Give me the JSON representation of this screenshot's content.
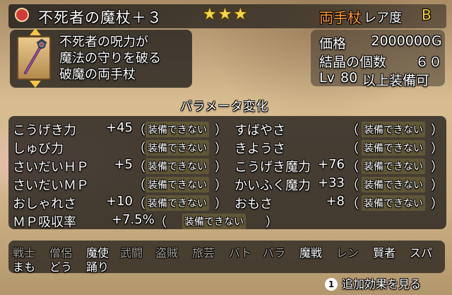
{
  "item": {
    "name": "不死者の魔杖＋３",
    "stars": "★★★",
    "weapon_type": "両手杖",
    "rarity_label": "レア度",
    "rarity_value": "B",
    "description": [
      "不死者の呪力が",
      "魔法の守りを破る",
      "破魔の両手杖"
    ]
  },
  "info": {
    "price_label": "価格",
    "price_value": "2000000",
    "price_unit": "G",
    "crystal_label": "結晶の個数",
    "crystal_value": "６０",
    "level_prefix": "Lv",
    "level_value": "80",
    "level_suffix": "以上装備可"
  },
  "params": {
    "title": "パラメータ変化",
    "rows": [
      {
        "label": "こうげき力",
        "value": "+45",
        "open": "（",
        "note": "装備できない",
        "close": "）"
      },
      {
        "label": "すばやさ",
        "value": "",
        "open": "（",
        "note": "装備できない",
        "close": "）"
      },
      {
        "label": "しゅび力",
        "value": "",
        "open": "（",
        "note": "装備できない",
        "close": "）"
      },
      {
        "label": "きようさ",
        "value": "",
        "open": "（",
        "note": "装備できない",
        "close": "）"
      },
      {
        "label": "さいだいＨＰ",
        "value": "+5",
        "open": "（",
        "note": "装備できない",
        "close": "）"
      },
      {
        "label": "こうげき魔力",
        "value": "+76",
        "open": "（",
        "note": "装備できない",
        "close": "）"
      },
      {
        "label": "さいだいＭＰ",
        "value": "",
        "open": "（",
        "note": "装備できない",
        "close": "）"
      },
      {
        "label": "かいふく魔力",
        "value": "+33",
        "open": "（",
        "note": "装備できない",
        "close": "）"
      },
      {
        "label": "おしゃれさ",
        "value": "+10",
        "open": "（",
        "note": "装備できない",
        "close": "）"
      },
      {
        "label": "おもさ",
        "value": "+8",
        "open": "（",
        "note": "装備できない",
        "close": "）"
      },
      {
        "label": "ＭＰ吸収率",
        "value": "+7.5%",
        "open": "（",
        "note": "装備できない",
        "close": "）"
      }
    ]
  },
  "jobs": {
    "row1": [
      {
        "label": "戦士",
        "on": false
      },
      {
        "label": "僧侶",
        "on": false
      },
      {
        "label": "魔使",
        "on": true
      },
      {
        "label": "武闘",
        "on": false
      },
      {
        "label": "盗賊",
        "on": false
      },
      {
        "label": "旅芸",
        "on": false
      },
      {
        "label": "バト",
        "on": false
      },
      {
        "label": "パラ",
        "on": false
      },
      {
        "label": "魔戦",
        "on": true
      },
      {
        "label": "レン",
        "on": false
      },
      {
        "label": "賢者",
        "on": true
      },
      {
        "label": "スパ",
        "on": true
      }
    ],
    "row2": [
      {
        "label": "まも",
        "on": true
      },
      {
        "label": "どう",
        "on": true
      },
      {
        "label": "踊り",
        "on": true
      }
    ]
  },
  "footer": {
    "button_glyph": "1",
    "label": "追加効果を見る"
  },
  "colors": {
    "weapon_type": "#ff9a3a",
    "rarity": "#ffd23a",
    "stars": "#f5d74a"
  }
}
